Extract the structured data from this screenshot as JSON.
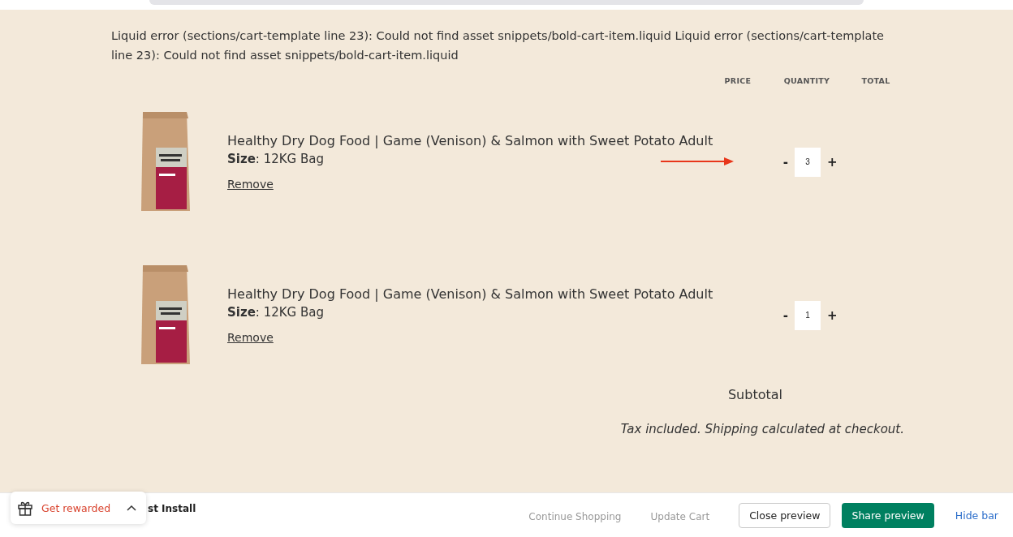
{
  "error_message": "Liquid error (sections/cart-template line 23): Could not find asset snippets/bold-cart-item.liquid Liquid error (sections/cart-template line 23): Could not find asset snippets/bold-cart-item.liquid",
  "columns": [
    "PRICE",
    "QUANTITY",
    "TOTAL"
  ],
  "items": [
    {
      "title": "Healthy Dry Dog Food | Game (Venison) & Salmon with Sweet Potato Adult",
      "size": "**Size**: 12KG Bag",
      "remove": "Remove",
      "minus": "-",
      "quantity": "3",
      "plus": "+",
      "arrow": true
    },
    {
      "title": "Healthy Dry Dog Food | Game (Venison) & Salmon with Sweet Potato Adult",
      "size": "**Size**: 12KG Bag",
      "remove": "Remove",
      "minus": "-",
      "quantity": "1",
      "plus": "+",
      "arrow": false
    }
  ],
  "subtotal_label": "Subtotal",
  "tax_note": "Tax included. Shipping calculated at checkout.",
  "footer_buttons": [
    "Continue Shopping",
    "Update Cart"
  ],
  "preview_bar": {
    "partial_text": "st Install",
    "close": "Close preview",
    "share": "Share preview",
    "hide": "Hide bar"
  },
  "rewards": {
    "label": "Get rewarded"
  }
}
